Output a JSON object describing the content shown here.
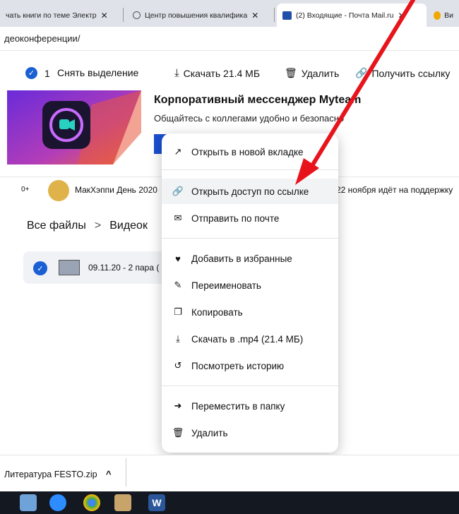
{
  "tabs": [
    {
      "label": "чать книги по теме Электр",
      "close": "✕"
    },
    {
      "label": "Центр повышения квалифика",
      "close": "✕"
    },
    {
      "label": "(2) Входящие - Почта Mail.ru",
      "close": "✕"
    },
    {
      "label": "Ви"
    }
  ],
  "address": {
    "url": "деоконференции/"
  },
  "toolbar": {
    "selected_count": "1",
    "deselect_label": "Снять выделение",
    "download_label": "Скачать 21.4 МБ",
    "delete_label": "Удалить",
    "get_link_label": "Получить ссылку"
  },
  "banner": {
    "title": "Корпоративный мессенджер Myteam",
    "subtitle": "Общайтесь с коллегами удобно и безопасно"
  },
  "news": {
    "badge": "0+",
    "text_left": "МакХэппи День 2020",
    "text_right": "22 ноября идёт на поддержку"
  },
  "breadcrumb": {
    "root": "Все файлы",
    "separator": ">",
    "current": "Видеок"
  },
  "file": {
    "name": "09.11.20 - 2 пара ("
  },
  "menu": {
    "items": [
      {
        "label": "Открыть в новой вкладке",
        "icon": "external-link-icon"
      },
      {
        "label": "Открыть доступ по ссылке",
        "icon": "link-icon"
      },
      {
        "label": "Отправить по почте",
        "icon": "mail-icon"
      },
      {
        "label": "Добавить в избранные",
        "icon": "heart-icon"
      },
      {
        "label": "Переименовать",
        "icon": "edit-icon"
      },
      {
        "label": "Копировать",
        "icon": "copy-icon"
      },
      {
        "label": "Скачать в .mp4 (21.4 МБ)",
        "icon": "download-icon"
      },
      {
        "label": "Посмотреть историю",
        "icon": "history-icon"
      },
      {
        "label": "Переместить в папку",
        "icon": "move-icon"
      },
      {
        "label": "Удалить",
        "icon": "trash-icon"
      }
    ]
  },
  "download_bar": {
    "filename": "Литература FESTO.zip",
    "chevron": "^"
  },
  "colors": {
    "accent": "#1a5fd3",
    "arrow": "#e8141c",
    "taskbar": "#141821"
  }
}
